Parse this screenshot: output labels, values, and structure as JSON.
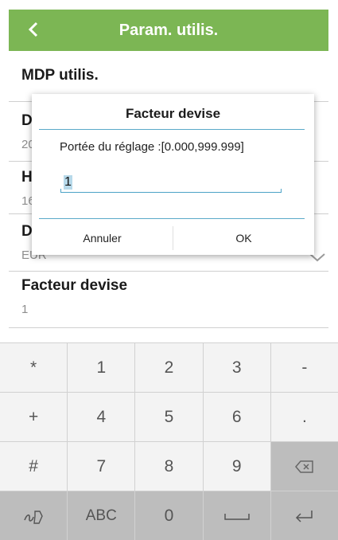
{
  "header": {
    "title": "Param. utilis."
  },
  "settings": [
    {
      "title": "MDP utilis.",
      "value": ""
    },
    {
      "title": "D",
      "value": "20"
    },
    {
      "title": "H",
      "value": "16"
    },
    {
      "title": "D",
      "value": "EUR"
    },
    {
      "title": "Facteur devise",
      "value": "1"
    }
  ],
  "dialog": {
    "title": "Facteur devise",
    "range_text": "Portée du réglage :[0.000,999.999]",
    "input_value": "1",
    "cancel_label": "Annuler",
    "ok_label": "OK"
  },
  "keyboard": {
    "row1": [
      "*",
      "1",
      "2",
      "3",
      "-"
    ],
    "row2": [
      "+",
      "4",
      "5",
      "6",
      "."
    ],
    "row3": [
      "#",
      "7",
      "8",
      "9"
    ],
    "row4_mid": [
      "ABC",
      "0"
    ]
  },
  "icons": {
    "back": "chevron-left-icon",
    "backspace": "backspace-icon",
    "space": "space-bar-icon",
    "enter": "enter-icon",
    "handwriting": "handwriting-icon",
    "dropdown": "chevron-down-icon"
  },
  "colors": {
    "toolbar": "#7cb654",
    "accent": "#4ba2c6",
    "keyboard_bg": "#d1d1d1"
  }
}
